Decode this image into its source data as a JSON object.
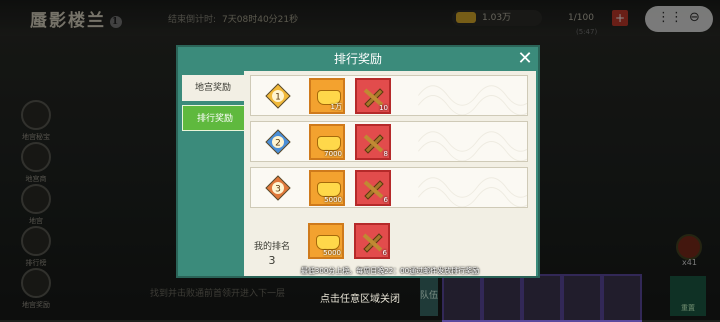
{
  "header": {
    "game_title": "蜃影楼兰",
    "title_badge": "1",
    "countdown_label": "结束倒计时:",
    "countdown_value": "7天08时40分21秒",
    "gold_amount": "1.03万",
    "stamina": "1/100",
    "stamina_plus": "+",
    "stamina_sub": "(5:47)"
  },
  "left_rail": [
    {
      "label": "地宫秘宝",
      "icon": "treasure-icon"
    },
    {
      "label": "地宫商",
      "icon": "merchant-icon"
    },
    {
      "label": "地宫",
      "icon": "dungeon-icon"
    },
    {
      "label": "排行榜",
      "icon": "ranking-icon"
    },
    {
      "label": "地宫奖励",
      "icon": "reward-icon"
    }
  ],
  "bottom": {
    "hint": "找到并击败通前首领开进入下一层",
    "close_hint": "点击任意区域关闭",
    "team_label": "队伍",
    "potion_count": "x41",
    "reset_label": "重置"
  },
  "dialog": {
    "title": "排行奖励",
    "tabs": [
      {
        "label": "地宫奖励",
        "active": false
      },
      {
        "label": "排行奖励",
        "active": true
      }
    ],
    "rows": [
      {
        "rank": "1",
        "medal_color": "#f1b93a",
        "rewards": [
          {
            "type": "gold",
            "qty": "1万"
          },
          {
            "type": "tool",
            "qty": "10"
          }
        ]
      },
      {
        "rank": "2",
        "medal_color": "#4b8fd8",
        "rewards": [
          {
            "type": "gold",
            "qty": "7000"
          },
          {
            "type": "tool",
            "qty": "8"
          }
        ]
      },
      {
        "rank": "3",
        "medal_color": "#e0783a",
        "rewards": [
          {
            "type": "gold",
            "qty": "5000"
          },
          {
            "type": "tool",
            "qty": "6"
          }
        ]
      }
    ],
    "my_rank": {
      "label": "我的排名",
      "value": "3",
      "rewards": [
        {
          "type": "gold",
          "qty": "5000"
        },
        {
          "type": "tool",
          "qty": "6"
        }
      ]
    },
    "footer_note": "最低300分上榜。每周日晚22：00通过邮件发放排行奖励"
  }
}
